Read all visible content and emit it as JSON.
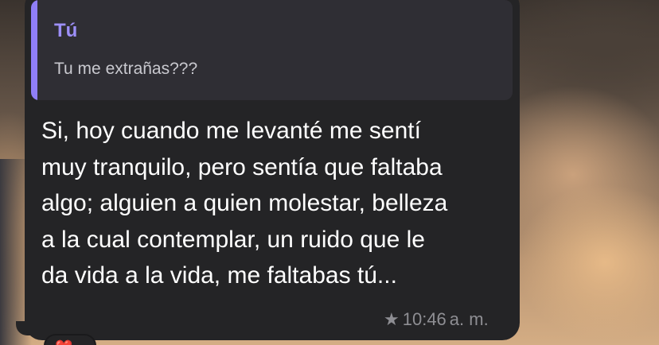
{
  "reply_quote": {
    "author": "Tú",
    "text": "Tu me extrañas???"
  },
  "message": {
    "lines": [
      "Si, hoy cuando me levanté me sentí",
      "muy tranquilo, pero sentía que faltaba",
      "algo; alguien a quien molestar, belleza",
      "a la cual contemplar, un ruido que le",
      "da vida a la vida, me faltabas tú..."
    ],
    "time": "10:46",
    "ampm": "a. m.",
    "starred_icon": "star-icon"
  },
  "reaction": {
    "icon": "heart-icon",
    "emoji": "❤️"
  },
  "colors": {
    "bubble": "#242426",
    "quote_bg": "#2f2e34",
    "accent": "#8f7ef7",
    "meta": "#8e8e93"
  }
}
